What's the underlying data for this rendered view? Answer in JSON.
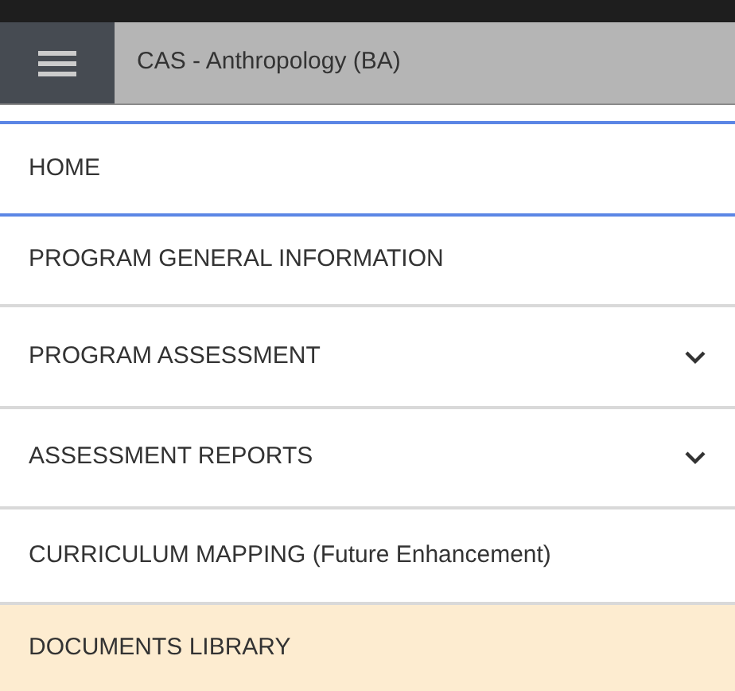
{
  "header": {
    "title": "CAS - Anthropology (BA)"
  },
  "menu": [
    {
      "label": "HOME",
      "focused": true,
      "selected": false,
      "expandable": false
    },
    {
      "label": "PROGRAM GENERAL INFORMATION",
      "focused": false,
      "selected": false,
      "expandable": false
    },
    {
      "label": "PROGRAM ASSESSMENT",
      "focused": false,
      "selected": false,
      "expandable": true
    },
    {
      "label": "ASSESSMENT REPORTS",
      "focused": false,
      "selected": false,
      "expandable": true
    },
    {
      "label": "CURRICULUM MAPPING (Future Enhancement)",
      "focused": false,
      "selected": false,
      "expandable": false
    },
    {
      "label": "DOCUMENTS LIBRARY",
      "focused": false,
      "selected": true,
      "expandable": false
    }
  ]
}
